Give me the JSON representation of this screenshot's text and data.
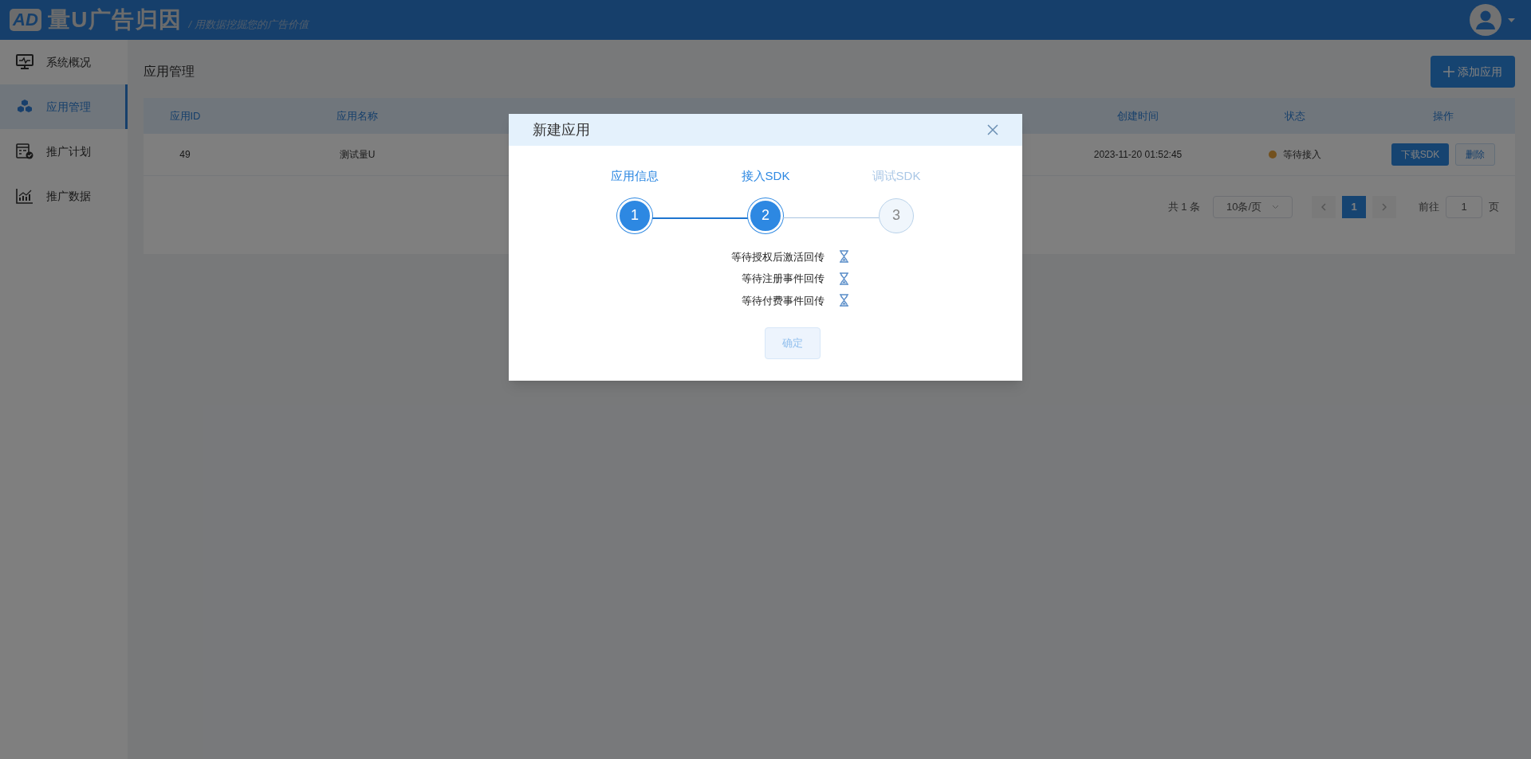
{
  "header": {
    "logo_mark": "AD",
    "brand": "量U广告归因",
    "slogan": "/ 用数据挖掘您的广告价值"
  },
  "sidebar": {
    "items": [
      {
        "label": "系统概况",
        "selected": false
      },
      {
        "label": "应用管理",
        "selected": true
      },
      {
        "label": "推广计划",
        "selected": false
      },
      {
        "label": "推广数据",
        "selected": false
      }
    ]
  },
  "page": {
    "title": "应用管理",
    "add_button": "添加应用"
  },
  "table": {
    "columns": [
      "应用ID",
      "应用名称",
      "创建时间",
      "状态",
      "操作"
    ],
    "rows": [
      {
        "id": "49",
        "name": "测试量U",
        "created": "2023-11-20 01:52:45",
        "status": "等待接入",
        "color": "#73511e",
        "actions": [
          "下载SDK",
          "删除"
        ]
      }
    ]
  },
  "pagination": {
    "total": "共 1 条",
    "page_size": "10条/页",
    "pages": [
      {
        "label": "1",
        "selected": true
      }
    ],
    "goto_label": "前往",
    "goto_value": "1",
    "goto_suffix": "页"
  },
  "dialog": {
    "title": "新建应用",
    "steps": [
      {
        "label": "应用信息",
        "number": "1",
        "finished": true
      },
      {
        "label": "接入SDK",
        "number": "2",
        "finished": true
      },
      {
        "label": "调试SDK",
        "number": "3",
        "finished": false
      }
    ],
    "checks": [
      "等待授权后激活回传",
      "等待注册事件回传",
      "等待付费事件回传"
    ],
    "confirm": {
      "label": "确定",
      "disabled": true
    }
  }
}
